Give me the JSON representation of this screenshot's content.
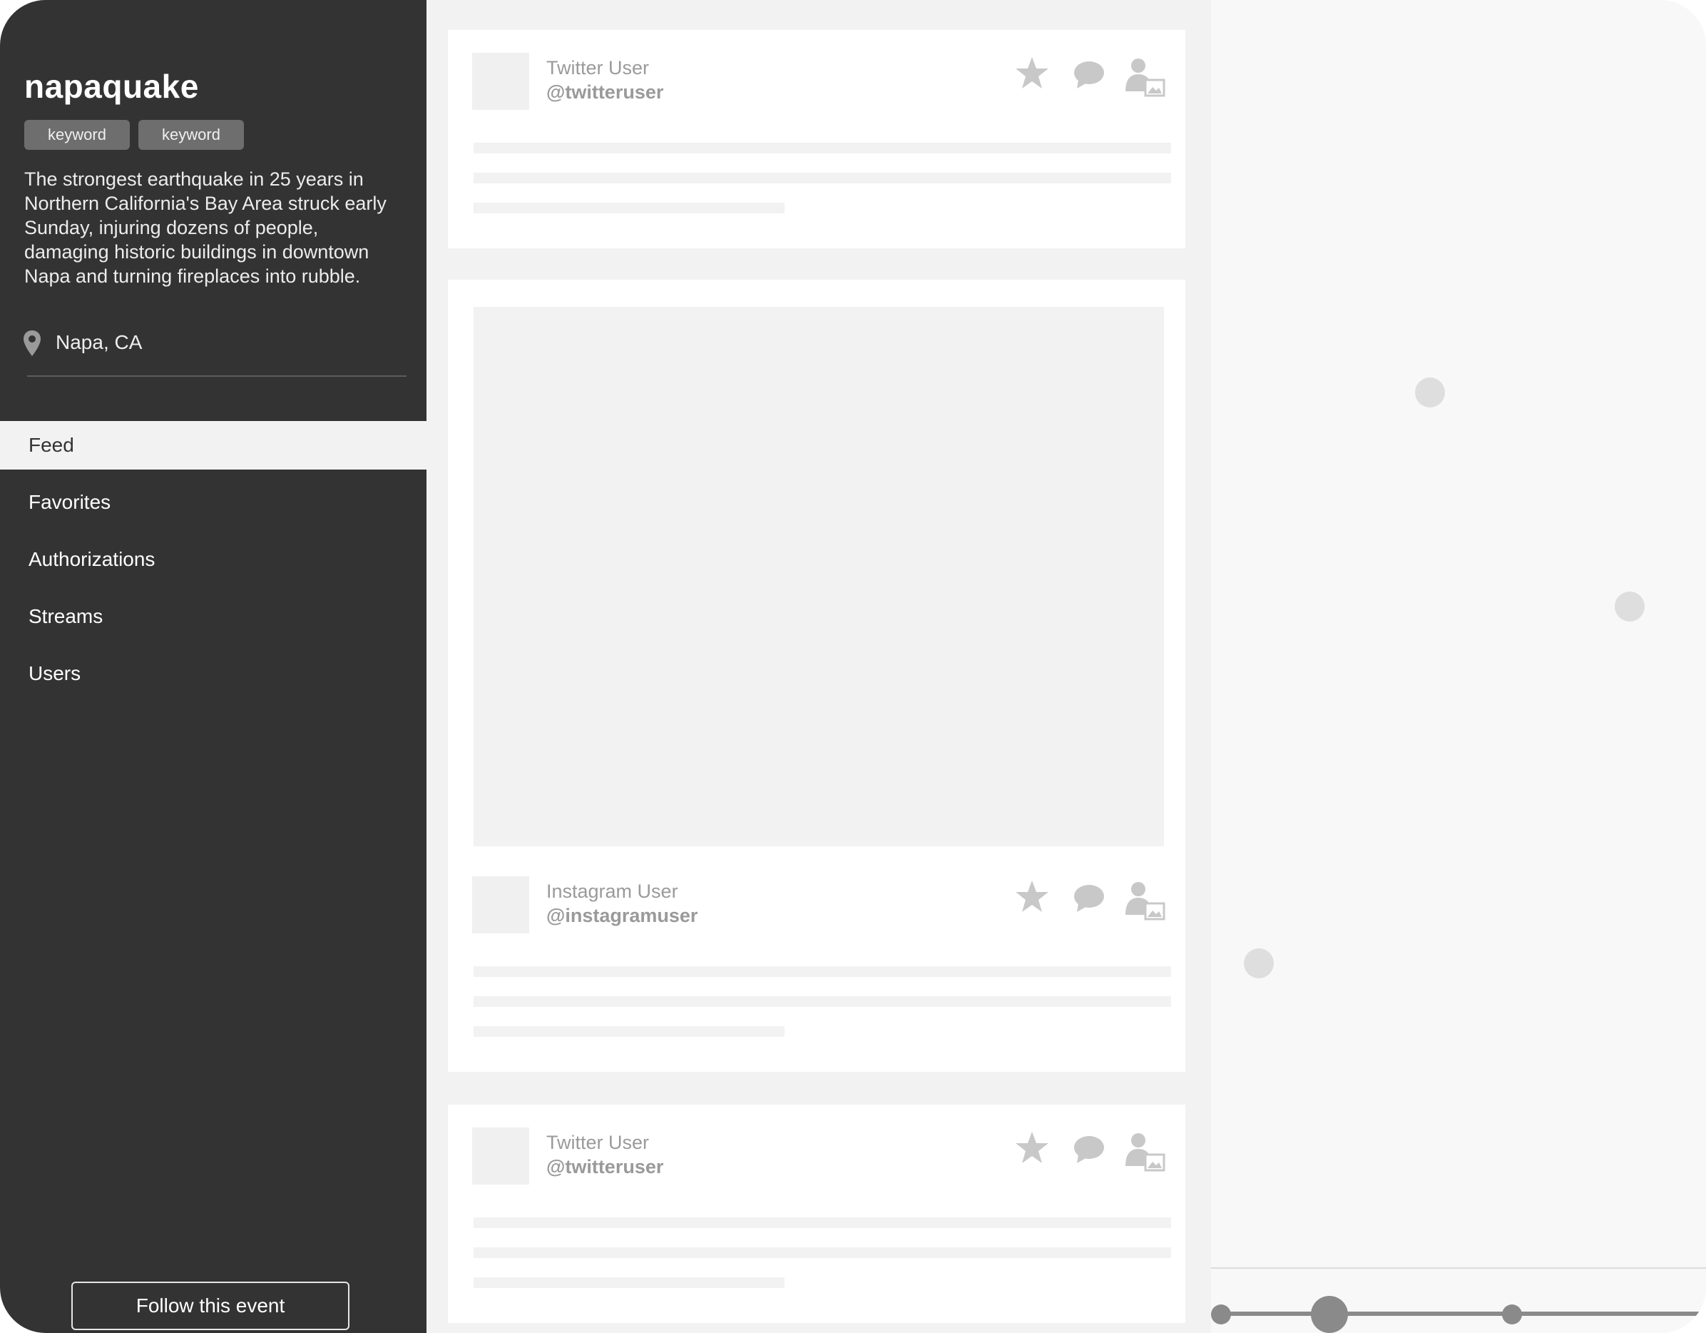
{
  "event": {
    "title": "napaquake",
    "keywords": [
      "keyword",
      "keyword"
    ],
    "description": "The strongest earthquake in 25 years in Northern California's Bay Area struck early Sunday, injuring dozens of people, damaging historic buildings in downtown Napa and turning fireplaces into rubble.",
    "location": "Napa, CA"
  },
  "nav": {
    "items": [
      {
        "label": "Feed",
        "active": true
      },
      {
        "label": "Favorites",
        "active": false
      },
      {
        "label": "Authorizations",
        "active": false
      },
      {
        "label": "Streams",
        "active": false
      },
      {
        "label": "Users",
        "active": false
      }
    ]
  },
  "follow_button": {
    "label": "Follow this event"
  },
  "feed": {
    "posts": [
      {
        "name": "Twitter User",
        "handle": "@twitteruser",
        "has_media": false
      },
      {
        "name": "Instagram User",
        "handle": "@instagramuser",
        "has_media": true
      },
      {
        "name": "Twitter User",
        "handle": "@twitteruser",
        "has_media": false
      }
    ]
  },
  "icons": {
    "favorite": "star-icon",
    "comment": "speech-bubble-icon",
    "user_media": "user-media-icon",
    "location": "map-pin-icon"
  },
  "colors": {
    "sidebar_bg": "#333333",
    "feed_bg": "#f2f2f2",
    "card_bg": "#ffffff",
    "placeholder": "#f2f2f2",
    "icon": "#c8c8c8",
    "map_marker": "#dedede",
    "timeline": "#8a8a8a"
  }
}
